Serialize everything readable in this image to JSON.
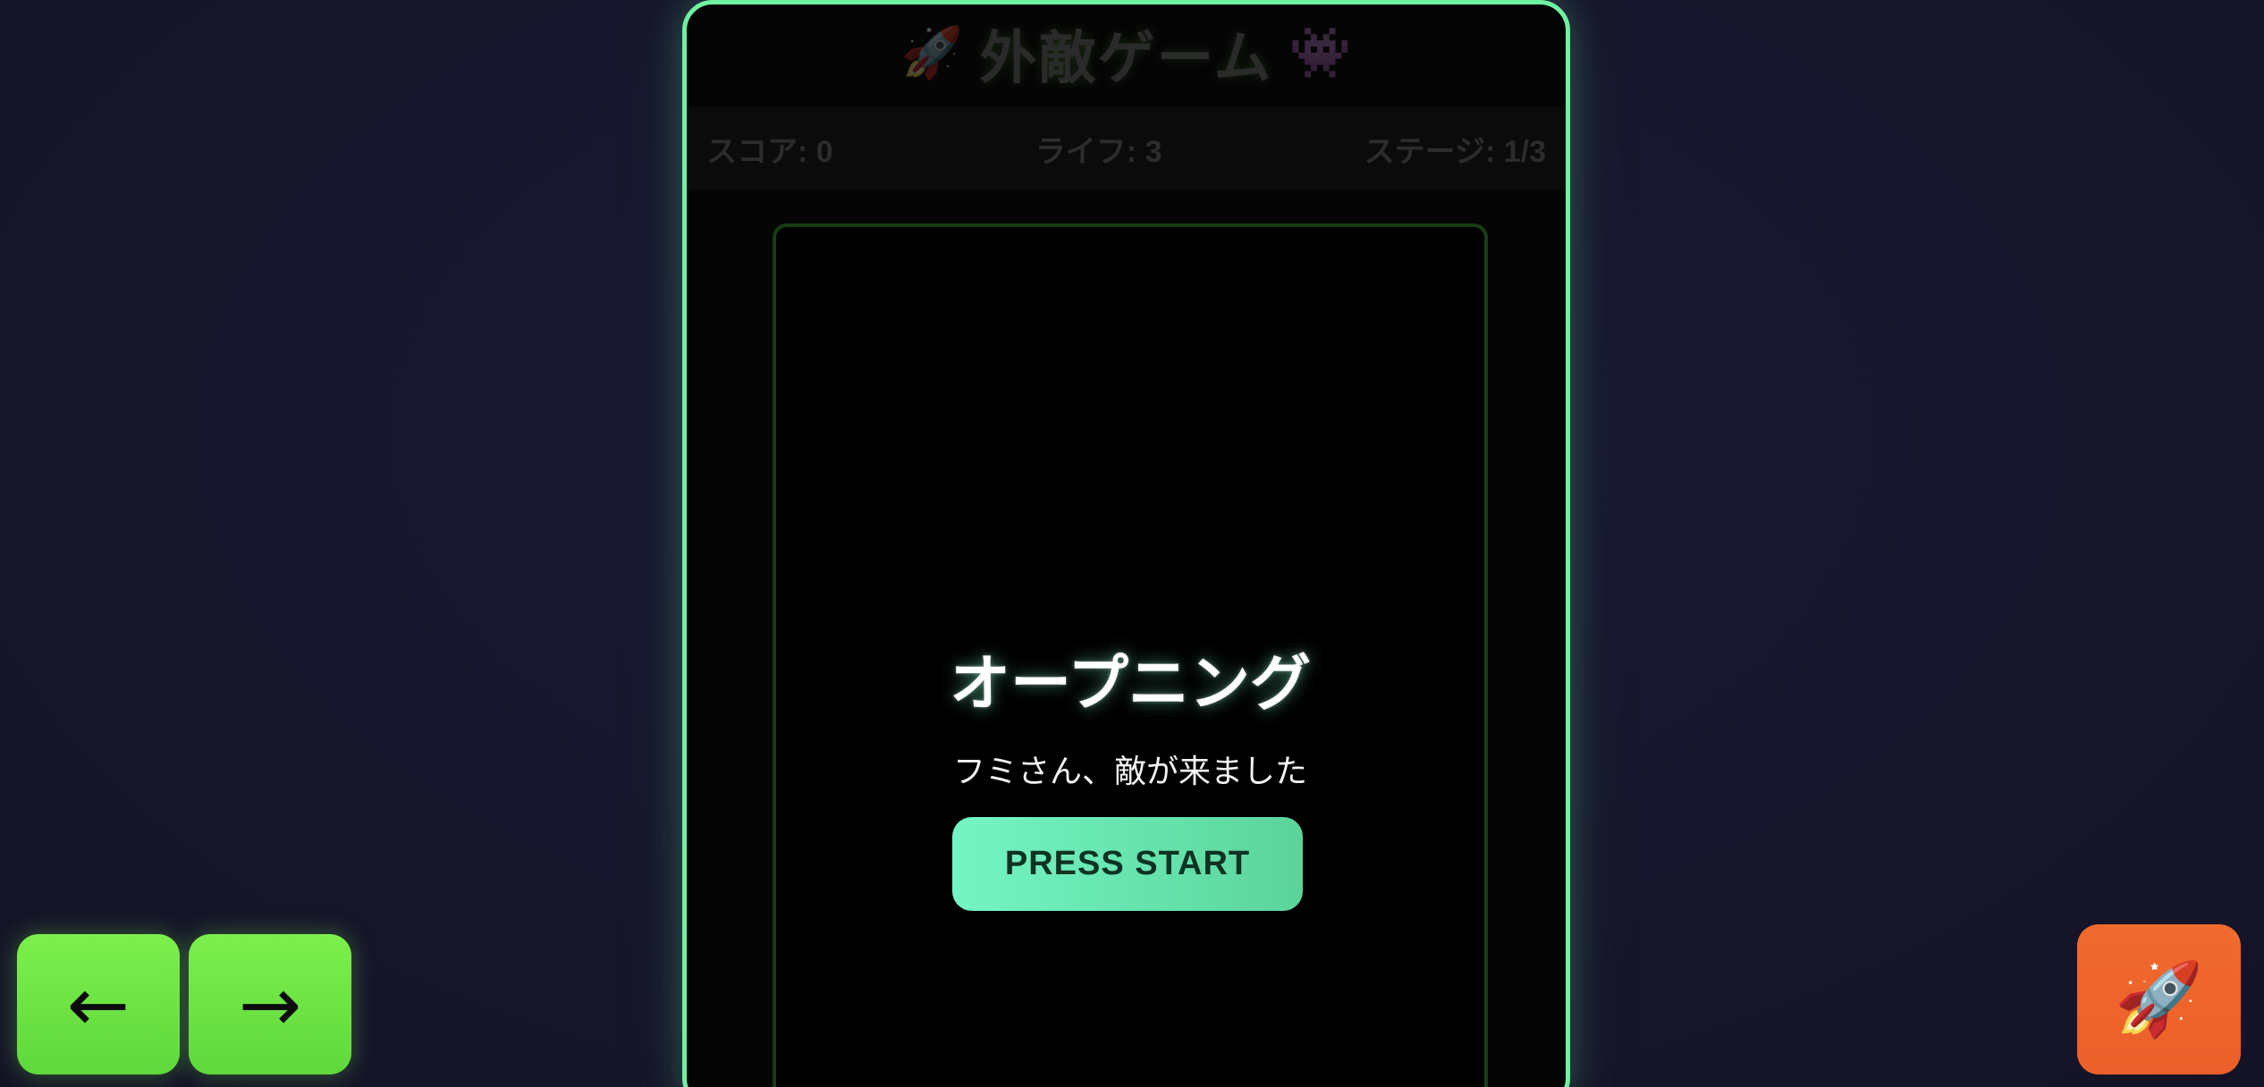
{
  "header": {
    "title": "外敵ゲーム",
    "left_icon": "🚀",
    "right_icon": "👾"
  },
  "stats": {
    "score": "スコア: 0",
    "lives": "ライフ: 3",
    "stage": "ステージ: 1/3"
  },
  "overlay": {
    "title": "オープニング",
    "message": "フミさん、敵が来ました",
    "start_label": "PRESS START"
  },
  "controls": {
    "left_label": "←",
    "right_label": "→",
    "fire_label": "🚀"
  },
  "colors": {
    "background": "#17162c",
    "frame_border": "#6ef2a0",
    "start_button": "#74f5c4",
    "arrow_button": "#6ee645",
    "fire_button": "#ee642c"
  }
}
